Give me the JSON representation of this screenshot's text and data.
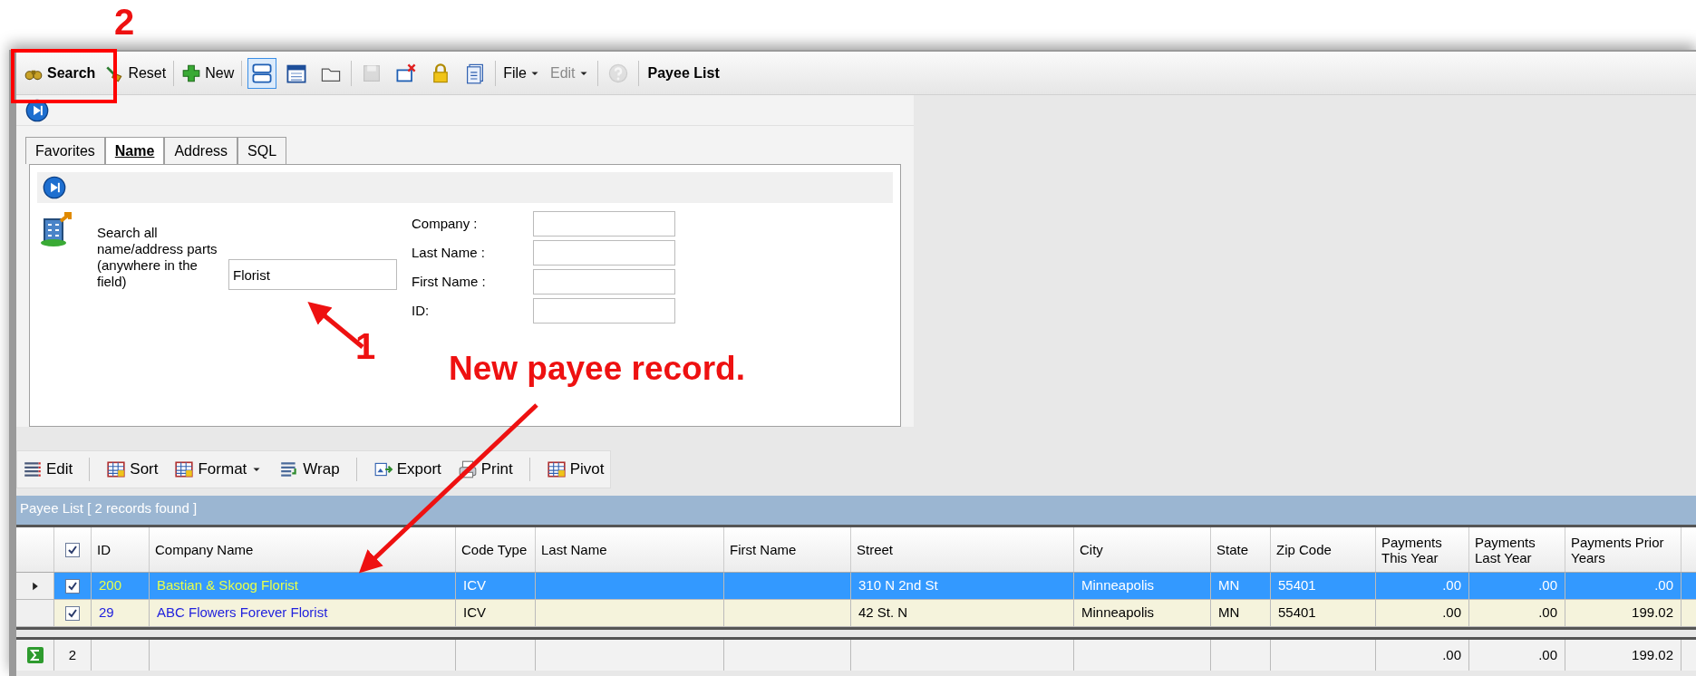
{
  "toolbar": [
    {
      "kind": "primary",
      "label": "Search",
      "disabled": false
    },
    {
      "kind": "button",
      "label": "Reset",
      "disabled": false
    },
    {
      "kind": "separator"
    },
    {
      "kind": "button",
      "label": "New",
      "disabled": false
    },
    {
      "kind": "separator"
    },
    {
      "kind": "icon",
      "selected": true,
      "disabled": false
    },
    {
      "kind": "icon",
      "selected": false,
      "disabled": false
    },
    {
      "kind": "icon",
      "selected": false,
      "disabled": false
    },
    {
      "kind": "separator"
    },
    {
      "kind": "icon",
      "selected": false,
      "disabled": true
    },
    {
      "kind": "icon",
      "selected": false,
      "disabled": false
    },
    {
      "kind": "icon",
      "selected": false,
      "disabled": false
    },
    {
      "kind": "icon",
      "selected": false,
      "disabled": false
    },
    {
      "kind": "separator"
    },
    {
      "kind": "menu",
      "label": "File",
      "disabled": false
    },
    {
      "kind": "menu",
      "label": "Edit",
      "disabled": true
    },
    {
      "kind": "separator"
    },
    {
      "kind": "icon",
      "selected": false,
      "disabled": true
    },
    {
      "kind": "separator"
    },
    {
      "kind": "title",
      "label": "Payee List"
    }
  ],
  "tabs": [
    {
      "label": "Favorites",
      "selected": false
    },
    {
      "label": "Name",
      "selected": true
    },
    {
      "label": "Address",
      "selected": false
    },
    {
      "label": "SQL",
      "selected": false
    }
  ],
  "search_form": {
    "description": "Search all name/address parts (anywhere in the field)",
    "value": "Florist",
    "fields": [
      {
        "label": "Company :"
      },
      {
        "label": "Last Name :"
      },
      {
        "label": "First Name :"
      },
      {
        "label": "ID:"
      }
    ]
  },
  "grid_toolbar": [
    {
      "kind": "button",
      "label": "Edit"
    },
    {
      "kind": "separator"
    },
    {
      "kind": "button",
      "label": "Sort"
    },
    {
      "kind": "dropdown",
      "label": "Format"
    },
    {
      "kind": "button",
      "label": "Wrap"
    },
    {
      "kind": "separator"
    },
    {
      "kind": "button",
      "label": "Export"
    },
    {
      "kind": "button",
      "label": "Print"
    },
    {
      "kind": "separator"
    },
    {
      "kind": "button",
      "label": "Pivot"
    }
  ],
  "grid": {
    "title": "Payee List [ 2 records found ]",
    "all_checked": true,
    "columns": [
      "ID",
      "Company Name",
      "Code Type",
      "Last Name",
      "First Name",
      "Street",
      "City",
      "State",
      "Zip Code",
      "Payments This Year",
      "Payments Last Year",
      "Payments Prior Years"
    ],
    "rows": [
      {
        "selected": true,
        "checked": true,
        "cells": [
          "200",
          "Bastian & Skoog Florist",
          "ICV",
          "",
          "",
          "310 N 2nd St",
          "Minneapolis",
          "MN",
          "55401",
          ".00",
          ".00",
          ".00"
        ]
      },
      {
        "selected": false,
        "checked": true,
        "cells": [
          "29",
          "ABC Flowers Forever Florist",
          "ICV",
          "",
          "",
          "42 St. N",
          "Minneapolis",
          "MN",
          "55401",
          ".00",
          ".00",
          "199.02"
        ]
      }
    ],
    "footer": {
      "count": "2",
      "totals": [
        ".00",
        ".00",
        "199.02"
      ]
    }
  },
  "annotations": [
    {
      "kind": "step",
      "label": "2"
    },
    {
      "kind": "step",
      "label": "1"
    },
    {
      "kind": "callout",
      "label": "New payee record."
    }
  ]
}
